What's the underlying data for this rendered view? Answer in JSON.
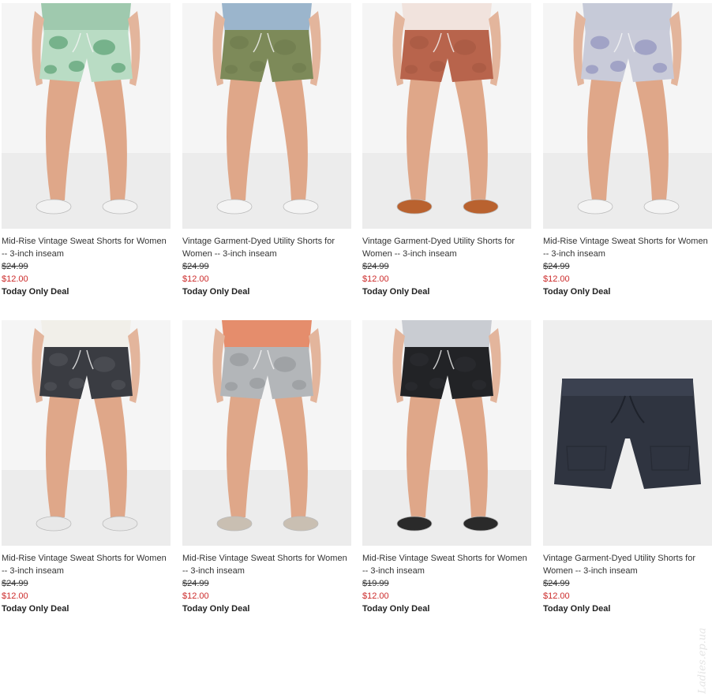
{
  "products": [
    {
      "title": "Mid-Rise Vintage Sweat Shorts for Women -- 3-inch inseam",
      "was_price": "$24.99",
      "sale_price": "$12.00",
      "badge": "Today Only Deal",
      "short_color": "#b9dcc4",
      "print_color": "#3f8f5c",
      "scene": "model",
      "shoe_color": "#f2f2f2",
      "top_color": "#9fc9ae"
    },
    {
      "title": "Vintage Garment-Dyed Utility Shorts for Women -- 3-inch inseam",
      "was_price": "$24.99",
      "sale_price": "$12.00",
      "badge": "Today Only Deal",
      "short_color": "#7d8a59",
      "print_color": "#6c794a",
      "scene": "model",
      "shoe_color": "#f4f4f4",
      "top_color": "#9bb5cc"
    },
    {
      "title": "Vintage Garment-Dyed Utility Shorts for Women -- 3-inch inseam",
      "was_price": "$24.99",
      "sale_price": "$12.00",
      "badge": "Today Only Deal",
      "short_color": "#b8644c",
      "print_color": "#a35540",
      "scene": "model",
      "shoe_color": "#b9622f",
      "top_color": "#f1e3dd"
    },
    {
      "title": "Mid-Rise Vintage Sweat Shorts for Women -- 3-inch inseam",
      "was_price": "$24.99",
      "sale_price": "$12.00",
      "badge": "Today Only Deal",
      "short_color": "#c9cbd9",
      "print_color": "#7f84b7",
      "scene": "model",
      "shoe_color": "#f4f4f4",
      "top_color": "#c6cad8"
    },
    {
      "title": "Mid-Rise Vintage Sweat Shorts for Women -- 3-inch inseam",
      "was_price": "$24.99",
      "sale_price": "$12.00",
      "badge": "Today Only Deal",
      "short_color": "#3a3c42",
      "print_color": "#55585f",
      "scene": "model",
      "shoe_color": "#e8e8e8",
      "top_color": "#f1efe9"
    },
    {
      "title": "Mid-Rise Vintage Sweat Shorts for Women -- 3-inch inseam",
      "was_price": "$24.99",
      "sale_price": "$12.00",
      "badge": "Today Only Deal",
      "short_color": "#b3b6b9",
      "print_color": "#8e9296",
      "scene": "model",
      "shoe_color": "#c9bfb2",
      "top_color": "#e58d6c"
    },
    {
      "title": "Mid-Rise Vintage Sweat Shorts for Women -- 3-inch inseam",
      "was_price": "$19.99",
      "sale_price": "$12.00",
      "badge": "Today Only Deal",
      "short_color": "#222326",
      "print_color": "#2e2f33",
      "scene": "model",
      "shoe_color": "#2a2a2a",
      "top_color": "#c9ccd2"
    },
    {
      "title": "Vintage Garment-Dyed Utility Shorts for Women -- 3-inch inseam",
      "was_price": "$24.99",
      "sale_price": "$12.00",
      "badge": "Today Only Deal",
      "short_color": "#2f3440",
      "print_color": "#3b4150",
      "scene": "flat",
      "shoe_color": "#2f3440",
      "top_color": "#2f3440"
    }
  ],
  "watermark": "Ladies.ep.ua"
}
